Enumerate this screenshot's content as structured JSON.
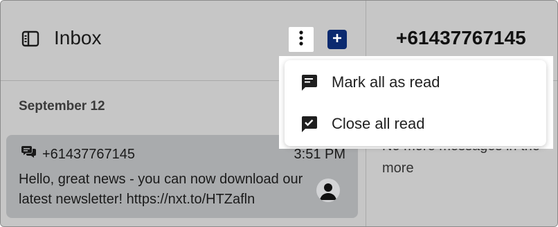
{
  "inbox": {
    "title": "Inbox",
    "date_heading": "September 12",
    "conversation": {
      "phone": "+61437767145",
      "time": "3:51 PM",
      "preview": "Hello, great news - you can now download our latest newsletter!  https://nxt.to/HTZafln"
    }
  },
  "conversation_pane": {
    "title": "+61437767145",
    "status": "No more messages in the more"
  },
  "menu": {
    "items": [
      {
        "label": "Mark all as read",
        "icon": "message-lines-icon"
      },
      {
        "label": "Close all read",
        "icon": "message-check-icon"
      }
    ]
  },
  "colors": {
    "compose_button": "#0b2a6f",
    "overlay": "#c6c6c6",
    "card": "#a9abad"
  }
}
